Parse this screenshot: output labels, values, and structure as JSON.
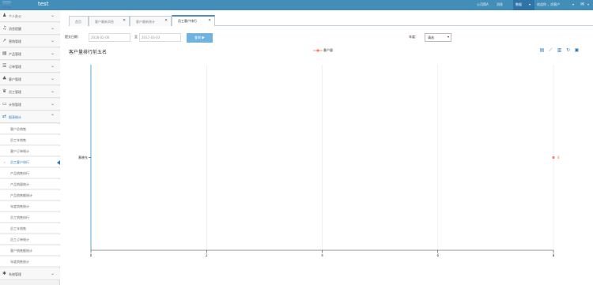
{
  "app": {
    "brand": "test"
  },
  "topbar": {
    "links": [
      "公司简A",
      "消息",
      "",
      "收件箱"
    ],
    "active_menu": "数据",
    "user_menu": "欢迎你 ，尚客户",
    "mail_icon": "mail-icon"
  },
  "sidebar": {
    "items": [
      {
        "icon": "user-icon",
        "label": "个人办公"
      },
      {
        "icon": "bell-icon",
        "label": "消息提醒"
      },
      {
        "icon": "chart-icon",
        "label": "营销管理"
      },
      {
        "icon": "folder-icon",
        "label": "产品管理"
      },
      {
        "icon": "list-icon",
        "label": "订单管理"
      },
      {
        "icon": "users-icon",
        "label": "客户管理"
      },
      {
        "icon": "trophy-icon",
        "label": "员工管理"
      },
      {
        "icon": "folder-open-icon",
        "label": "计划管理"
      },
      {
        "icon": "exchange-icon",
        "label": "报表统计"
      }
    ],
    "submenu": [
      "客户总销售",
      "员工年销售",
      "客户订单统计",
      "员工客户排行",
      "产品销售排行",
      "产品销量统计",
      "产品销售额统计",
      "年度销售统计",
      "员工销售排行",
      "员工年销售",
      "员工订单统计",
      "客户销售额统计",
      "年度销售统计"
    ],
    "active_submenu_index": 3,
    "last_item": {
      "icon": "gear-icon",
      "label": "系统管理"
    }
  },
  "tabs": [
    {
      "label": "首页"
    },
    {
      "label": "客户最新消息"
    },
    {
      "label": "客户最新统计"
    },
    {
      "label": "员工客户排行"
    }
  ],
  "filters": {
    "date_label": "提交日期：",
    "date_from": "2018-02-06",
    "to_label": "至",
    "date_to": "2017-03-03",
    "query_button": "查询 ▶",
    "select_label": "年度：",
    "select_value": "请选"
  },
  "chart_data": {
    "type": "scatter",
    "title": "客户量排行前五名",
    "series": [
      {
        "name": "客户量",
        "color": "#ff7f50",
        "points": [
          {
            "x": 8,
            "y": "黄晓东",
            "label": "8"
          }
        ]
      }
    ],
    "x_ticks": [
      0,
      2,
      4,
      6,
      8
    ],
    "xlim": [
      0,
      8
    ],
    "categories": [
      "黄晓东"
    ],
    "grid": true,
    "legend_position": "top-center",
    "toolbox_icons": [
      "data-view-icon",
      "line-chart-icon",
      "bar-chart-icon",
      "refresh-icon",
      "save-image-icon"
    ]
  }
}
